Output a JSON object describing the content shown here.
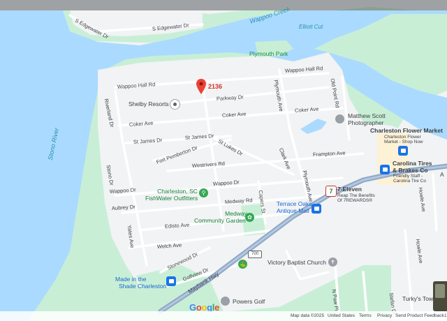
{
  "map": {
    "pin": {
      "label": "2136"
    },
    "water_labels": {
      "wappoo_creek": "Wappoo Creek",
      "elliott_cut": "Elliott Cut",
      "stono_river": "Stono River"
    },
    "parks": {
      "plymouth_park": "Plymouth Park"
    },
    "streets": {
      "s_edgewater_dr_1": "S Edgewater Dr",
      "s_edgewater_dr_2": "S Edgewater Dr",
      "wappoo_hall_rd_1": "Wappoo Hall Rd",
      "wappoo_hall_rd_2": "Wappoo Hall Rd",
      "old_point_rd": "Old Point Rd",
      "parkway_dr": "Parkway Dr",
      "riverland_dr": "Riverland Dr",
      "plymouth_ave_1": "Plymouth Ave",
      "plymouth_ave_2": "Plymouth Ave",
      "coker_ave_1": "Coker Ave",
      "coker_ave_2": "Coker Ave",
      "coker_ave_3": "Coker Ave",
      "st_james_dr_1": "St James Dr",
      "st_james_dr_2": "St James Dr",
      "st_lukes_dr": "St Lukes Dr",
      "fort_pemberton_dr": "Fort Pemberton Dr",
      "clark_ave": "Clark Ave",
      "frampton_ave": "Frampton Ave",
      "westrivers_rd": "Westrivers Rd",
      "stono_dr": "Stono Dr",
      "wappoo_dr_1": "Wappoo Dr",
      "wappoo_dr_2": "Wappoo Dr",
      "medway_rd": "Medway Rd",
      "capers_st": "Capers St",
      "aubrey_dr": "Aubrey Dr",
      "yates_ave": "Yates Ave",
      "edisto_ave": "Edisto Ave",
      "welch_ave": "Welch Ave",
      "stonewood_dr": "Stonewood Dr",
      "golfview_dr": "Golfview Dr",
      "maybank_hwy": "Maybank Hwy",
      "howle_ave_1": "Howle Ave",
      "howle_ave_2": "Howle Ave",
      "stefan_dr": "Stefan Dr",
      "n_paw_pl": "N Paw Pl"
    },
    "highway_badge": "700",
    "pois": {
      "shelby_resorts": "Shelby Resorts",
      "matthew_scott_1": "Matthew Scott",
      "matthew_scott_2": "Photographer",
      "flower_market_1": "Charleston Flower Market",
      "flower_market_2": "Charleston Flower",
      "flower_market_3": "Market - Shop Now",
      "carolina_tires_1": "Carolina Tires",
      "carolina_tires_2": "& Brakes Co",
      "carolina_tires_3": "Friendly Staff -",
      "carolina_tires_4": "Carolina Tire Co",
      "fishwater_1": "Charleston, SC",
      "fishwater_2": "FishWater Outfitters",
      "seven_eleven_1": "7-Eleven",
      "seven_eleven_2": "Reap The Benefits",
      "seven_eleven_3": "Of 7REWARDS®",
      "seven_eleven_badge": "7",
      "terrace_oaks_1": "Terrace Oaks",
      "terrace_oaks_2": "Antique Mall",
      "medway_garden_1": "Medway",
      "medway_garden_2": "Community Garden",
      "victory_baptist": "Victory Baptist Church",
      "made_in_shade_1": "Made in the",
      "made_in_shade_2": "Shade Charleston",
      "powers_golf": "Powers Golf",
      "turkys_town": "Turky's Town",
      "edge_label": "A"
    },
    "footer": {
      "map_data": "Map data ©2025",
      "united_states": "United States",
      "terms": "Terms",
      "privacy": "Privacy",
      "feedback": "Send Product Feedback",
      "scale": "1"
    },
    "google_logo": "Google",
    "colors": {
      "water": "#aadaff",
      "greenspace": "#c8efd6",
      "land": "#f1f3f4",
      "road": "#ffffff",
      "highway": "#8ea7c7",
      "pin": "#ea4335",
      "poi_blue": "#1a73e8",
      "poi_green": "#34a853"
    }
  }
}
